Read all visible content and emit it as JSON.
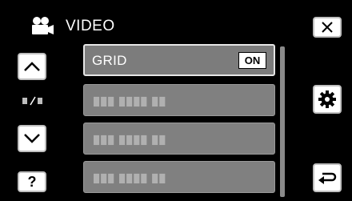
{
  "header": {
    "title": "VIDEO",
    "icon": "video-camera-icon"
  },
  "buttons": {
    "close_icon": "close-icon",
    "up_icon": "chevron-up-icon",
    "down_icon": "chevron-down-icon",
    "help_label": "?",
    "settings_icon": "gear-icon",
    "back_icon": "return-icon"
  },
  "page_indicator": "1/2",
  "menu": {
    "items": [
      {
        "label": "GRID",
        "value": "ON"
      },
      {
        "label": "███ ████ ██"
      },
      {
        "label": "███ ████ ██"
      },
      {
        "label": "███ ████ ██"
      }
    ]
  }
}
